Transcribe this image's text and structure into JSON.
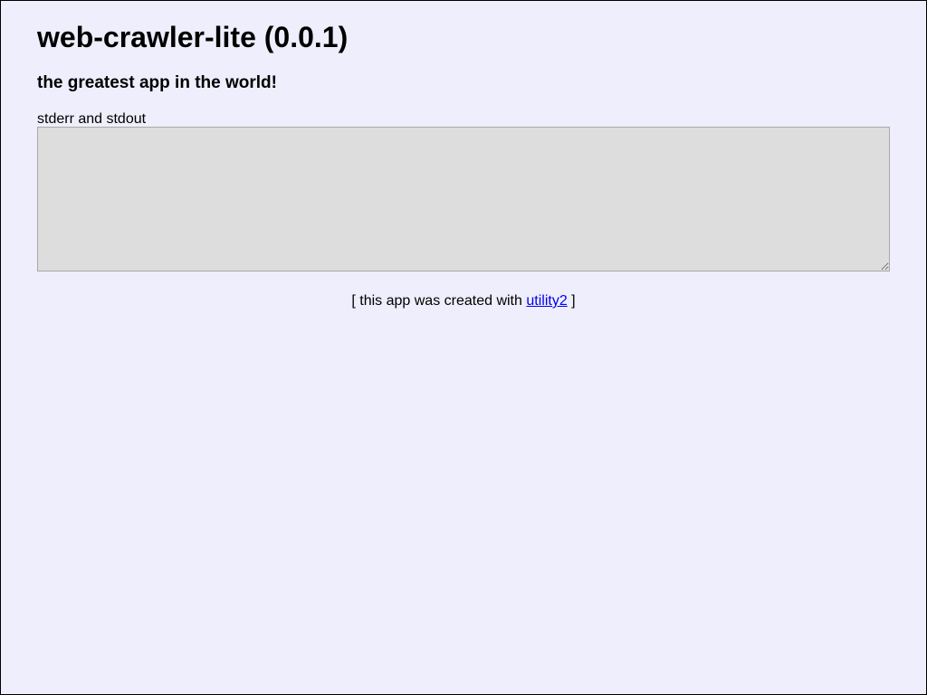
{
  "header": {
    "title": "web-crawler-lite (0.0.1)",
    "tagline": "the greatest app in the world!"
  },
  "output": {
    "label": "stderr and stdout",
    "value": ""
  },
  "footer": {
    "prefix": "[ this app was created with",
    "link_text": "utility2",
    "suffix": "]"
  },
  "colors": {
    "page_background": "#eeeefc",
    "textarea_background": "#dddddd",
    "link": "#0000ee"
  }
}
